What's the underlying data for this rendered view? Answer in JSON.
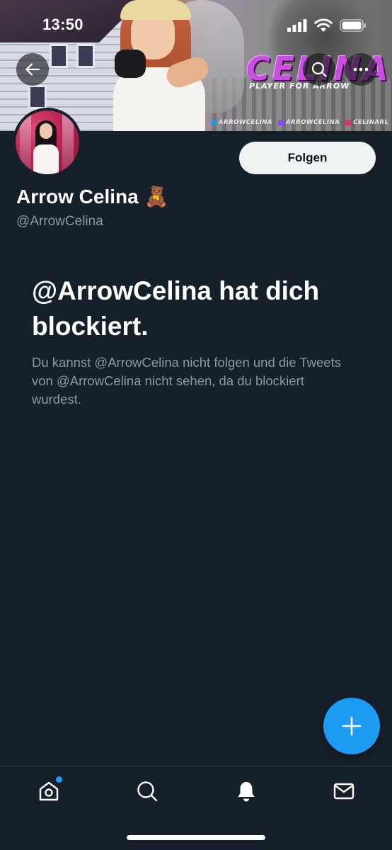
{
  "status_bar": {
    "time": "13:50",
    "icons": [
      "signal-icon",
      "wifi-icon",
      "battery-icon"
    ]
  },
  "banner": {
    "brand_title": "CELINA",
    "brand_subtitle": "PLAYER FOR ARROW",
    "socials": [
      {
        "label": "ARROWCELINA",
        "icon": "twitter-icon",
        "color": "#1d9bf0"
      },
      {
        "label": "ARROWCELINA",
        "icon": "twitch-icon",
        "color": "#9146ff"
      },
      {
        "label": "CELINARL",
        "icon": "instagram-icon",
        "color": "#e1306c"
      }
    ]
  },
  "header_actions": {
    "back_icon": "arrow-left-icon",
    "search_icon": "search-icon",
    "more_icon": "more-horizontal-icon"
  },
  "profile": {
    "display_name": "Arrow Celina",
    "emoji": "🧸",
    "handle": "@ArrowCelina",
    "follow_label": "Folgen"
  },
  "blocked": {
    "title": "@ArrowCelina hat dich blockiert.",
    "description": "Du kannst @ArrowCelina nicht folgen und die Tweets von @ArrowCelina nicht sehen, da du blockiert wurdest."
  },
  "fab": {
    "icon": "plus-icon",
    "color": "#1d9bf0"
  },
  "bottom_nav": {
    "items": [
      {
        "name": "home",
        "icon": "home-icon",
        "has_notification_dot": true
      },
      {
        "name": "search",
        "icon": "search-icon",
        "has_notification_dot": false
      },
      {
        "name": "notifications",
        "icon": "bell-icon",
        "has_notification_dot": false
      },
      {
        "name": "messages",
        "icon": "mail-icon",
        "has_notification_dot": false
      }
    ]
  },
  "colors": {
    "background": "#15202b",
    "accent": "#1d9bf0",
    "secondary_text": "#8b98a5",
    "brand_purple": "#c84fe0"
  }
}
